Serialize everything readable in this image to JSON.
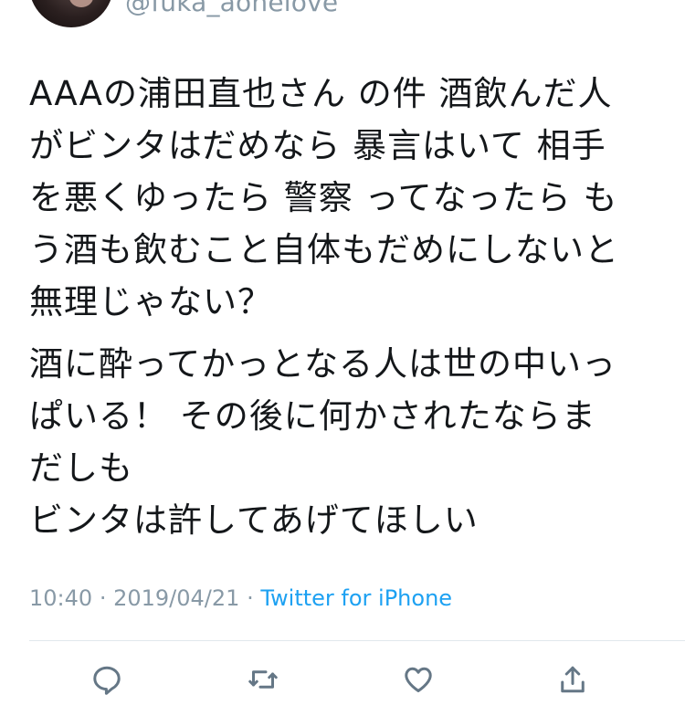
{
  "author": {
    "handle": "@fuka_aonelove"
  },
  "tweet": {
    "paragraphs": [
      [
        "AAAの浦田直也さん の件 酒飲んだ人",
        "がビンタはだめなら 暴言はいて 相手",
        "を悪くゆったら 警察 ってなったら も",
        "う酒も飲むこと自体もだめにしないと",
        "無理じゃない？"
      ],
      [
        "酒に酔ってかっとなる人は世の中いっ",
        "ぱいる！ その後に何かされたならま",
        "だしも",
        "ビンタは許してあげてほしい"
      ]
    ]
  },
  "meta": {
    "time": "10:40",
    "separator": "·",
    "date": "2019/04/21",
    "source": "Twitter for iPhone"
  },
  "actions": [
    {
      "name": "reply",
      "icon": "reply-icon"
    },
    {
      "name": "retweet",
      "icon": "retweet-icon"
    },
    {
      "name": "like",
      "icon": "heart-icon"
    },
    {
      "name": "share",
      "icon": "share-icon"
    }
  ],
  "colors": {
    "text": "#14171a",
    "secondary": "#8899a6",
    "link": "#1da1f2",
    "icon": "#657786",
    "divider": "#e1e8ed"
  }
}
